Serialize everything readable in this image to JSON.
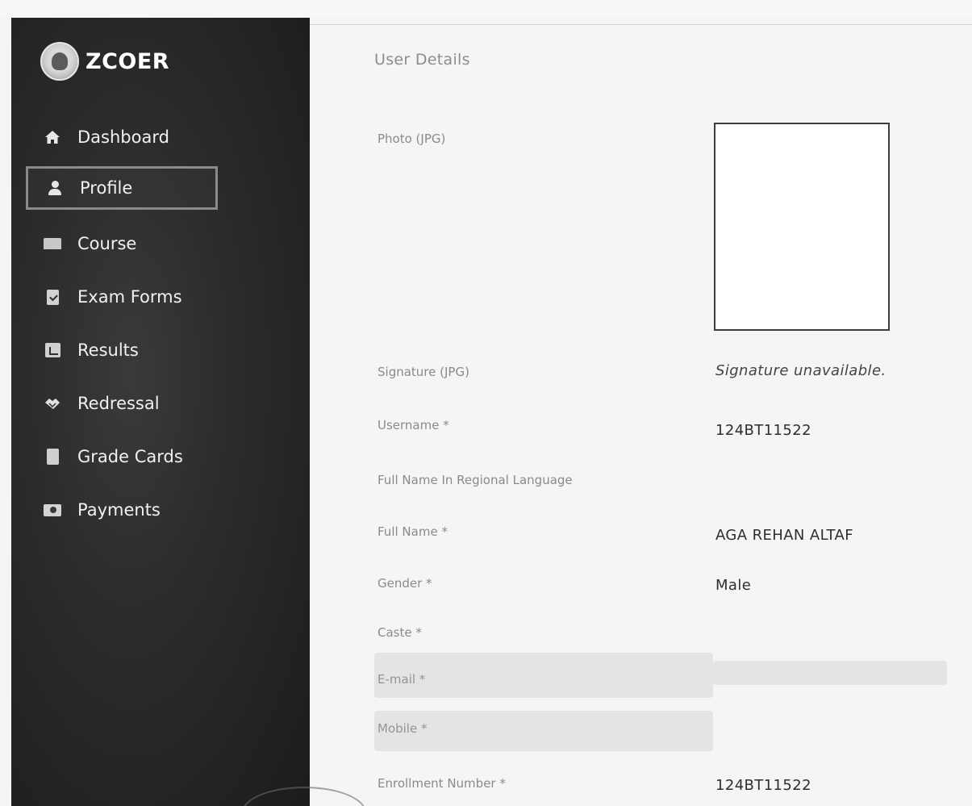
{
  "brand": {
    "name": "ZCOER",
    "logo": "college-emblem"
  },
  "sidebar": {
    "items": [
      {
        "label": "Dashboard",
        "icon": "home-icon"
      },
      {
        "label": "Profile",
        "icon": "user-icon",
        "active": true
      },
      {
        "label": "Course",
        "icon": "book-icon"
      },
      {
        "label": "Exam Forms",
        "icon": "clipboard-check-icon"
      },
      {
        "label": "Results",
        "icon": "chart-icon"
      },
      {
        "label": "Redressal",
        "icon": "handshake-icon"
      },
      {
        "label": "Grade Cards",
        "icon": "document-icon"
      },
      {
        "label": "Payments",
        "icon": "money-icon"
      }
    ]
  },
  "main": {
    "section_title": "User Details",
    "fields": {
      "photo": {
        "label": "Photo (JPG)"
      },
      "signature": {
        "label": "Signature (JPG)",
        "value": "Signature unavailable."
      },
      "username": {
        "label": "Username *",
        "value": "124BT11522"
      },
      "full_name_regional": {
        "label": "Full Name In Regional Language",
        "value": ""
      },
      "full_name": {
        "label": "Full Name *",
        "value": "AGA REHAN ALTAF"
      },
      "gender": {
        "label": "Gender *",
        "value": "Male"
      },
      "caste": {
        "label": "Caste *",
        "value": ""
      },
      "email": {
        "label": "E-mail *",
        "value": ""
      },
      "mobile": {
        "label": "Mobile *",
        "value": ""
      },
      "enrollment": {
        "label": "Enrollment Number *",
        "value": "124BT11522"
      }
    }
  },
  "colors": {
    "sidebar_bg": "#2a2a2a",
    "sidebar_text": "#f1f1f1",
    "label_text": "#8a8a8a",
    "value_text": "#2e2e2e",
    "page_bg": "#f5f5f3"
  }
}
